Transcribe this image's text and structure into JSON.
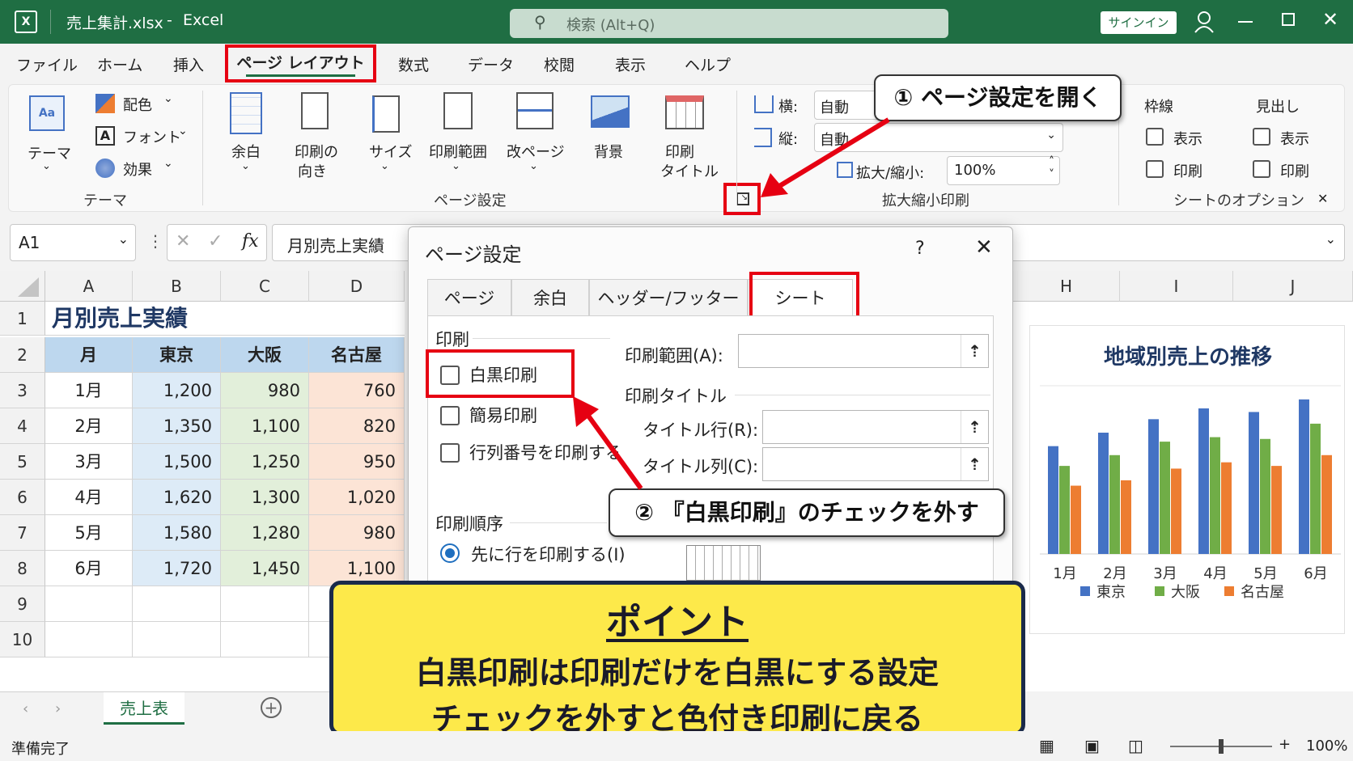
{
  "titlebar": {
    "filename": "売上集計.xlsx",
    "separator": "-",
    "app": "Excel",
    "search_placeholder": "検索 (Alt+Q)",
    "signin": "サインイン",
    "accent": "#1f6e43"
  },
  "menu": {
    "items": [
      "ファイル",
      "ホーム",
      "挿入",
      "ページ レイアウト",
      "数式",
      "データ",
      "校閲",
      "表示",
      "ヘルプ"
    ],
    "active": "ページ レイアウト"
  },
  "ribbon": {
    "theme": {
      "label": "テーマ",
      "colors": "配色",
      "fonts": "フォント",
      "effects": "効果",
      "group": "テーマ"
    },
    "page_setup": {
      "margins": "余白",
      "orientation_1": "印刷の",
      "orientation_2": "向き",
      "size": "サイズ",
      "print_area": "印刷範囲",
      "breaks": "改ページ",
      "background": "背景",
      "print_titles_1": "印刷",
      "print_titles_2": "タイトル",
      "group": "ページ設定"
    },
    "scale": {
      "width_label": "横:",
      "width_value": "自動",
      "height_label": "縦:",
      "height_value": "自動",
      "scale_label": "拡大/縮小:",
      "scale_value": "100%",
      "group": "拡大縮小印刷"
    },
    "sheet_options": {
      "gridlines": "枠線",
      "headings": "見出し",
      "view": "表示",
      "print": "印刷",
      "group": "シートのオプション"
    }
  },
  "formula_bar": {
    "name_box": "A1",
    "fx": "fx",
    "content": "月別売上実績"
  },
  "sheet": {
    "columns": [
      "A",
      "B",
      "C",
      "D"
    ],
    "right_columns": [
      "H",
      "I",
      "J"
    ],
    "rows": [
      "1",
      "2",
      "3",
      "4",
      "5",
      "6",
      "7",
      "8",
      "9",
      "10"
    ],
    "title": "月別売上実績",
    "headers": [
      "月",
      "東京",
      "大阪",
      "名古屋"
    ],
    "data": [
      [
        "1月",
        "1,200",
        "980",
        "760"
      ],
      [
        "2月",
        "1,350",
        "1,100",
        "820"
      ],
      [
        "3月",
        "1,500",
        "1,250",
        "950"
      ],
      [
        "4月",
        "1,620",
        "1,300",
        "1,020"
      ],
      [
        "5月",
        "1,580",
        "1,280",
        "980"
      ],
      [
        "6月",
        "1,720",
        "1,450",
        "1,100"
      ]
    ],
    "tab_name": "売上表",
    "colors": {
      "header": "#bdd7ee",
      "tokyo": "#ddebf7",
      "osaka": "#e2efda",
      "nagoya": "#fce4d6",
      "title": "#1f3864"
    }
  },
  "dialog": {
    "title": "ページ設定",
    "help": "?",
    "tabs": [
      "ページ",
      "余白",
      "ヘッダー/フッター",
      "シート"
    ],
    "active_tab": "シート",
    "print_section": "印刷",
    "checkboxes": [
      "白黒印刷",
      "簡易印刷",
      "行列番号を印刷する"
    ],
    "print_area_label": "印刷範囲(A):",
    "print_titles_section": "印刷タイトル",
    "title_rows_label": "タイトル行(R):",
    "title_cols_label": "タイトル列(C):",
    "page_order_section": "印刷順序",
    "page_order_option": "先に行を印刷する(I)"
  },
  "callouts": {
    "step1": "① ページ設定を開く",
    "step2": "② 『白黒印刷』のチェックを外す"
  },
  "point": {
    "heading": "ポイント",
    "line1": "白黒印刷は印刷だけを白黒にする設定",
    "line2": "チェックを外すと色付き印刷に戻る"
  },
  "chart_data": {
    "type": "bar",
    "title": "地域別売上の推移",
    "categories": [
      "1月",
      "2月",
      "3月",
      "4月",
      "5月",
      "6月"
    ],
    "series": [
      {
        "name": "東京",
        "values": [
          1200,
          1350,
          1500,
          1620,
          1580,
          1720
        ],
        "color": "#4472c4"
      },
      {
        "name": "大阪",
        "values": [
          980,
          1100,
          1250,
          1300,
          1280,
          1450
        ],
        "color": "#70ad47"
      },
      {
        "name": "名古屋",
        "values": [
          760,
          820,
          950,
          1020,
          980,
          1100
        ],
        "color": "#ed7d31"
      }
    ],
    "ylim": [
      0,
      1800
    ],
    "legend": "bottom",
    "grid": false
  },
  "status": {
    "ready": "準備完了",
    "zoom": "100%"
  }
}
